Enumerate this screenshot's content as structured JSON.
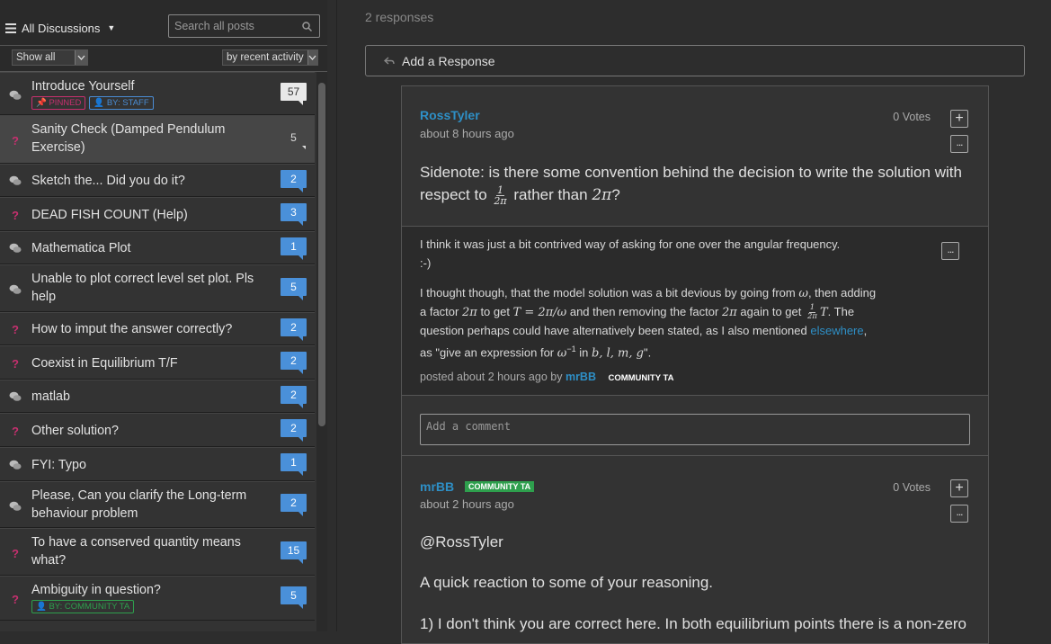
{
  "sidebar": {
    "menu_label": "All Discussions",
    "search_placeholder": "Search all posts",
    "show_filter": "Show all",
    "sort_filter": "by recent activity",
    "threads": [
      {
        "title": "Introduce Yourself",
        "type": "discussion",
        "count": "57",
        "badges": [
          "PINNED",
          "BY: STAFF"
        ]
      },
      {
        "title": "Sanity Check (Damped Pendulum Exercise)",
        "type": "question",
        "count": "5",
        "active": true
      },
      {
        "title": "Sketch the... Did you do it?",
        "type": "discussion",
        "count": "2"
      },
      {
        "title": "DEAD FISH COUNT (Help)",
        "type": "question",
        "count": "3"
      },
      {
        "title": "Mathematica Plot",
        "type": "discussion",
        "count": "1"
      },
      {
        "title": "Unable to plot correct level set plot. Pls help",
        "type": "discussion",
        "count": "5"
      },
      {
        "title": "How to imput the answer correctly?",
        "type": "question",
        "count": "2"
      },
      {
        "title": "Coexist in Equilibrium T/F",
        "type": "question",
        "count": "2"
      },
      {
        "title": "matlab",
        "type": "discussion",
        "count": "2"
      },
      {
        "title": "Other solution?",
        "type": "question",
        "count": "2"
      },
      {
        "title": "FYI: Typo",
        "type": "discussion",
        "count": "1"
      },
      {
        "title": "Please, Can you clarify the Long-term behaviour problem",
        "type": "discussion",
        "count": "2"
      },
      {
        "title": "To have a conserved quantity means what?",
        "type": "question",
        "count": "15"
      },
      {
        "title": "Ambiguity in question?",
        "type": "question",
        "count": "5",
        "badges": [
          "BY: COMMUNITY TA"
        ]
      }
    ]
  },
  "main": {
    "responses_count": "2 responses",
    "add_response_label": "Add a Response",
    "response1": {
      "author": "RossTyler",
      "time": "about 8 hours ago",
      "votes": "0 Votes",
      "text_a": "Sidenote: is there some convention behind the decision to write the solution with respect to",
      "text_b": "rather than",
      "frac_num": "1",
      "frac_den": "2π",
      "math_2pi": "2π",
      "text_c": "?"
    },
    "comment1": {
      "line1": "I think it was just a bit contrived way of asking for one over the angular frequency.",
      "line2": ":-)",
      "p2a": "I thought though, that the model solution was a bit devious by going from",
      "omega": "ω",
      "p2b": ", then adding a factor",
      "twopi": "2π",
      "p2c": "to get",
      "eq1": "T = 2π/ω",
      "p2d": "and then removing the factor",
      "p2e": "again to get",
      "frac_num": "1",
      "frac_den": "2π",
      "T": "T",
      "p2f": ". The question perhaps could have alternatively been stated, as I also mentioned",
      "link": "elsewhere",
      "p2g": ", as \"give an expression for",
      "omega_inv": "ω",
      "sup": "−1",
      "p2h": "in",
      "vars": "b, l, m, g",
      "p2i": "\".",
      "meta_prefix": "posted about 2 hours ago by",
      "meta_author": "mrBB",
      "meta_role": "COMMUNITY TA"
    },
    "comment_placeholder": "Add a comment",
    "response2": {
      "author": "mrBB",
      "role": "COMMUNITY TA",
      "time": "about 2 hours ago",
      "votes": "0 Votes",
      "para1": "@RossTyler",
      "para2": "A quick reaction to some of your reasoning.",
      "para3": "1) I don't think you are correct here. In both equilibrium points there is a non-zero"
    }
  },
  "colors": {
    "accent": "#2e8fc6",
    "count_badge": "#4a90d9",
    "question": "#c7306f",
    "community_ta": "#2e9f4d"
  }
}
